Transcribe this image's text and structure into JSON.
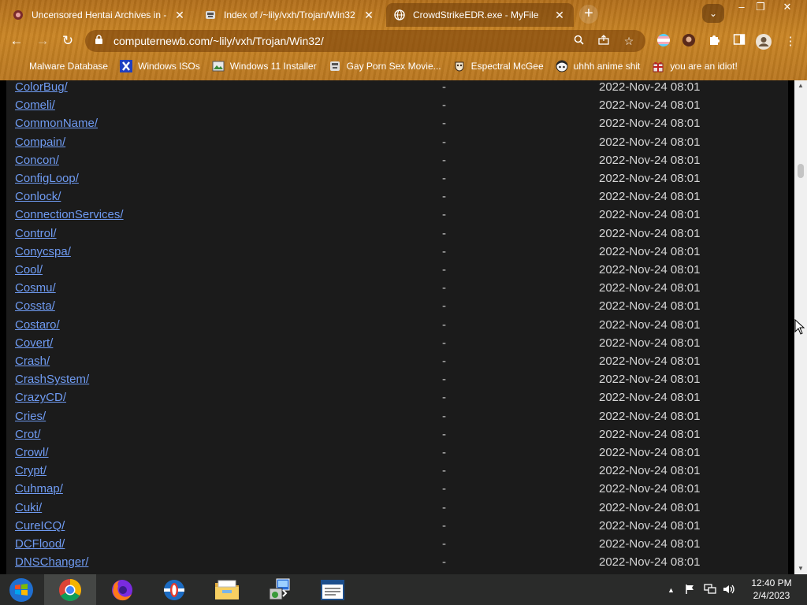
{
  "tabs": [
    {
      "title": "Uncensored Hentai Archives in - …",
      "icon": "hentai-favicon",
      "active": false
    },
    {
      "title": "Index of /~lily/vxh/Trojan/Win32",
      "icon": "archive-favicon",
      "active": false
    },
    {
      "title": "CrowdStrikeEDR.exe - MyFile",
      "icon": "globe-favicon",
      "active": true
    }
  ],
  "address_bar": {
    "url": "computernewb.com/~lily/vxh/Trojan/Win32/"
  },
  "bookmarks": [
    {
      "label": "Malware Database",
      "icon": "folder-icon"
    },
    {
      "label": "Windows ISOs",
      "icon": "x-icon"
    },
    {
      "label": "Windows 11 Installer",
      "icon": "image-icon"
    },
    {
      "label": "Gay Porn Sex Movie...",
      "icon": "archive-favicon"
    },
    {
      "label": "Espectral McGee",
      "icon": "mask-icon"
    },
    {
      "label": "uhhh anime shit",
      "icon": "anime-icon"
    },
    {
      "label": "you are an idiot!",
      "icon": "gift-icon"
    }
  ],
  "listing": [
    {
      "name": "ColorBug/",
      "size": "-",
      "date": "2022-Nov-24 08:01"
    },
    {
      "name": "Comeli/",
      "size": "-",
      "date": "2022-Nov-24 08:01"
    },
    {
      "name": "CommonName/",
      "size": "-",
      "date": "2022-Nov-24 08:01"
    },
    {
      "name": "Compain/",
      "size": "-",
      "date": "2022-Nov-24 08:01"
    },
    {
      "name": "Concon/",
      "size": "-",
      "date": "2022-Nov-24 08:01"
    },
    {
      "name": "ConfigLoop/",
      "size": "-",
      "date": "2022-Nov-24 08:01"
    },
    {
      "name": "Conlock/",
      "size": "-",
      "date": "2022-Nov-24 08:01"
    },
    {
      "name": "ConnectionServices/",
      "size": "-",
      "date": "2022-Nov-24 08:01"
    },
    {
      "name": "Control/",
      "size": "-",
      "date": "2022-Nov-24 08:01"
    },
    {
      "name": "Conycspa/",
      "size": "-",
      "date": "2022-Nov-24 08:01"
    },
    {
      "name": "Cool/",
      "size": "-",
      "date": "2022-Nov-24 08:01"
    },
    {
      "name": "Cosmu/",
      "size": "-",
      "date": "2022-Nov-24 08:01"
    },
    {
      "name": "Cossta/",
      "size": "-",
      "date": "2022-Nov-24 08:01"
    },
    {
      "name": "Costaro/",
      "size": "-",
      "date": "2022-Nov-24 08:01"
    },
    {
      "name": "Covert/",
      "size": "-",
      "date": "2022-Nov-24 08:01"
    },
    {
      "name": "Crash/",
      "size": "-",
      "date": "2022-Nov-24 08:01"
    },
    {
      "name": "CrashSystem/",
      "size": "-",
      "date": "2022-Nov-24 08:01"
    },
    {
      "name": "CrazyCD/",
      "size": "-",
      "date": "2022-Nov-24 08:01"
    },
    {
      "name": "Cries/",
      "size": "-",
      "date": "2022-Nov-24 08:01"
    },
    {
      "name": "Crot/",
      "size": "-",
      "date": "2022-Nov-24 08:01"
    },
    {
      "name": "Crowl/",
      "size": "-",
      "date": "2022-Nov-24 08:01"
    },
    {
      "name": "Crypt/",
      "size": "-",
      "date": "2022-Nov-24 08:01"
    },
    {
      "name": "Cuhmap/",
      "size": "-",
      "date": "2022-Nov-24 08:01"
    },
    {
      "name": "Cuki/",
      "size": "-",
      "date": "2022-Nov-24 08:01"
    },
    {
      "name": "CureICQ/",
      "size": "-",
      "date": "2022-Nov-24 08:01"
    },
    {
      "name": "DCFlood/",
      "size": "-",
      "date": "2022-Nov-24 08:01"
    },
    {
      "name": "DNSChanger/",
      "size": "-",
      "date": "2022-Nov-24 08:01"
    }
  ],
  "taskbar": {
    "apps": [
      {
        "name": "start-button",
        "icon": "windows-start-icon",
        "active": false
      },
      {
        "name": "chrome-app",
        "icon": "chrome-icon",
        "active": true
      },
      {
        "name": "firefox-app",
        "icon": "firefox-icon",
        "active": false
      },
      {
        "name": "opera-app",
        "icon": "opera-icon",
        "active": false
      },
      {
        "name": "explorer-app",
        "icon": "file-explorer-icon",
        "active": false
      },
      {
        "name": "installer-app",
        "icon": "installer-icon",
        "active": false
      },
      {
        "name": "notepad-app",
        "icon": "notepad-icon",
        "active": false
      }
    ],
    "clock": {
      "time": "12:40 PM",
      "date": "2/4/2023"
    }
  },
  "colors": {
    "link": "#6f9bf2",
    "page_bg": "#1b1b1b",
    "chrome": "#c98424",
    "taskbar": "#2a2b2a"
  }
}
